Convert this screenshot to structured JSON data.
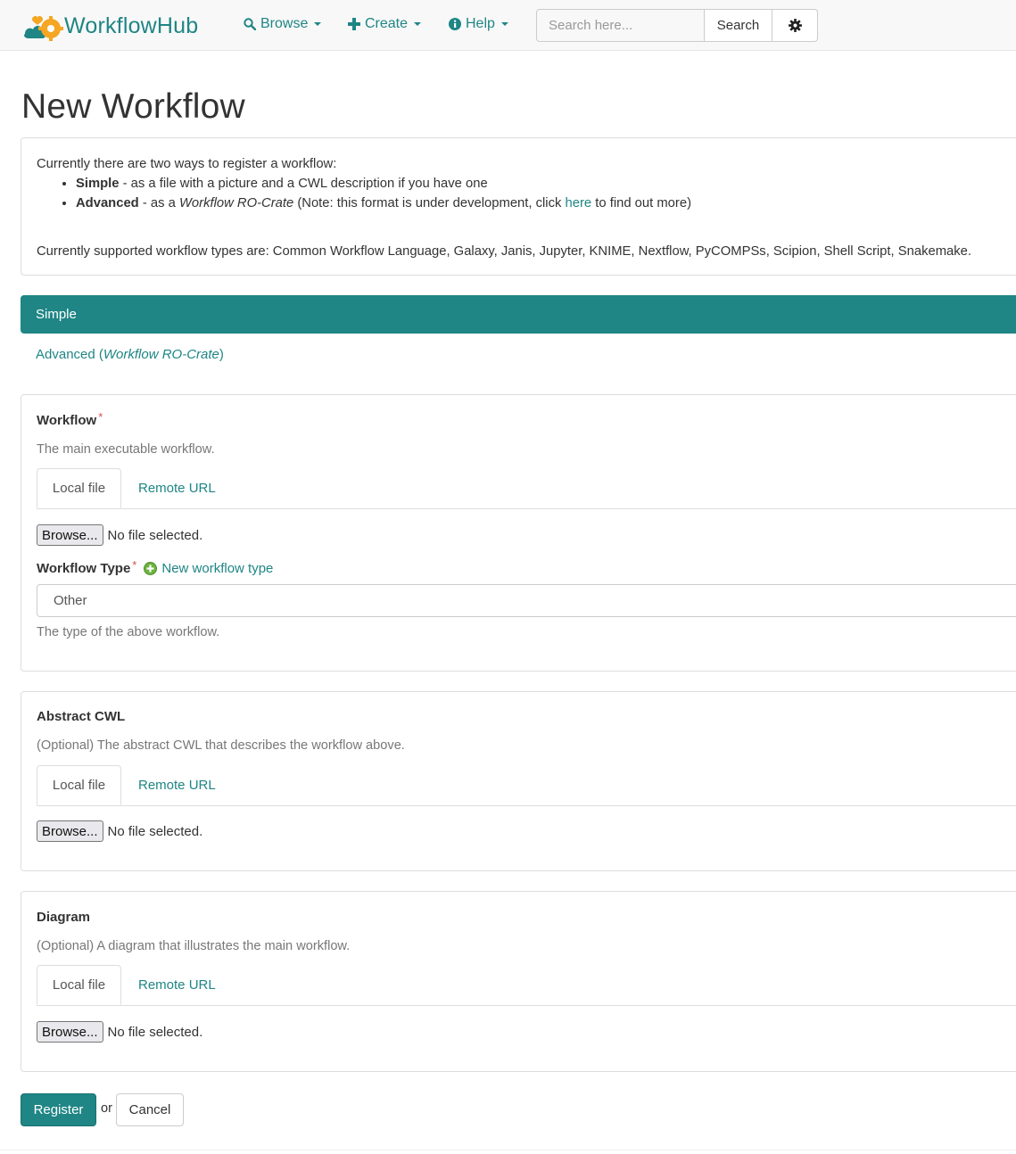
{
  "brand": {
    "name": "WorkflowHub"
  },
  "navbar": {
    "items": [
      {
        "label": "Browse",
        "icon": "search-icon"
      },
      {
        "label": "Create",
        "icon": "plus-icon"
      },
      {
        "label": "Help",
        "icon": "info-circle-icon"
      }
    ],
    "search": {
      "placeholder": "Search here...",
      "button_label": "Search"
    },
    "settings_icon": "gear-icon"
  },
  "page": {
    "title": "New Workflow"
  },
  "info": {
    "intro": "Currently there are two ways to register a workflow:",
    "simple_term": "Simple",
    "simple_desc": " - as a file with a picture and a CWL description if you have one",
    "advanced_term": "Advanced",
    "advanced_desc_1": " - as a ",
    "advanced_desc_em": "Workflow RO-Crate",
    "advanced_desc_2": " (Note: this format is under development, click ",
    "advanced_link": "here",
    "advanced_desc_3": " to find out more)",
    "supported": "Currently supported workflow types are: Common Workflow Language, Galaxy, Janis, Jupyter, KNIME, Nextflow, PyCOMPSs, Scipion, Shell Script, Snakemake."
  },
  "mode_tabs": {
    "simple": "Simple",
    "advanced_prefix": "Advanced (",
    "advanced_em": "Workflow RO-Crate",
    "advanced_suffix": ")"
  },
  "workflow_panel": {
    "label": "Workflow",
    "required_mark": "*",
    "help": "The main executable workflow.",
    "tab_local": "Local file",
    "tab_remote": "Remote URL",
    "browse_label": "Browse...",
    "file_status": "No file selected.",
    "type_label": "Workflow Type",
    "type_required_mark": "*",
    "new_type_link": "New workflow type",
    "type_value": "Other",
    "type_help": "The type of the above workflow."
  },
  "abstract_panel": {
    "label": "Abstract CWL",
    "help": "(Optional) The abstract CWL that describes the workflow above.",
    "tab_local": "Local file",
    "tab_remote": "Remote URL",
    "browse_label": "Browse...",
    "file_status": "No file selected."
  },
  "diagram_panel": {
    "label": "Diagram",
    "help": "(Optional) A diagram that illustrates the main workflow.",
    "tab_local": "Local file",
    "tab_remote": "Remote URL",
    "browse_label": "Browse...",
    "file_status": "No file selected."
  },
  "actions": {
    "register": "Register",
    "or": "or",
    "cancel": "Cancel"
  },
  "colors": {
    "accent": "#1f8585",
    "logo_orange": "#f5a623",
    "required": "#d9534f"
  }
}
